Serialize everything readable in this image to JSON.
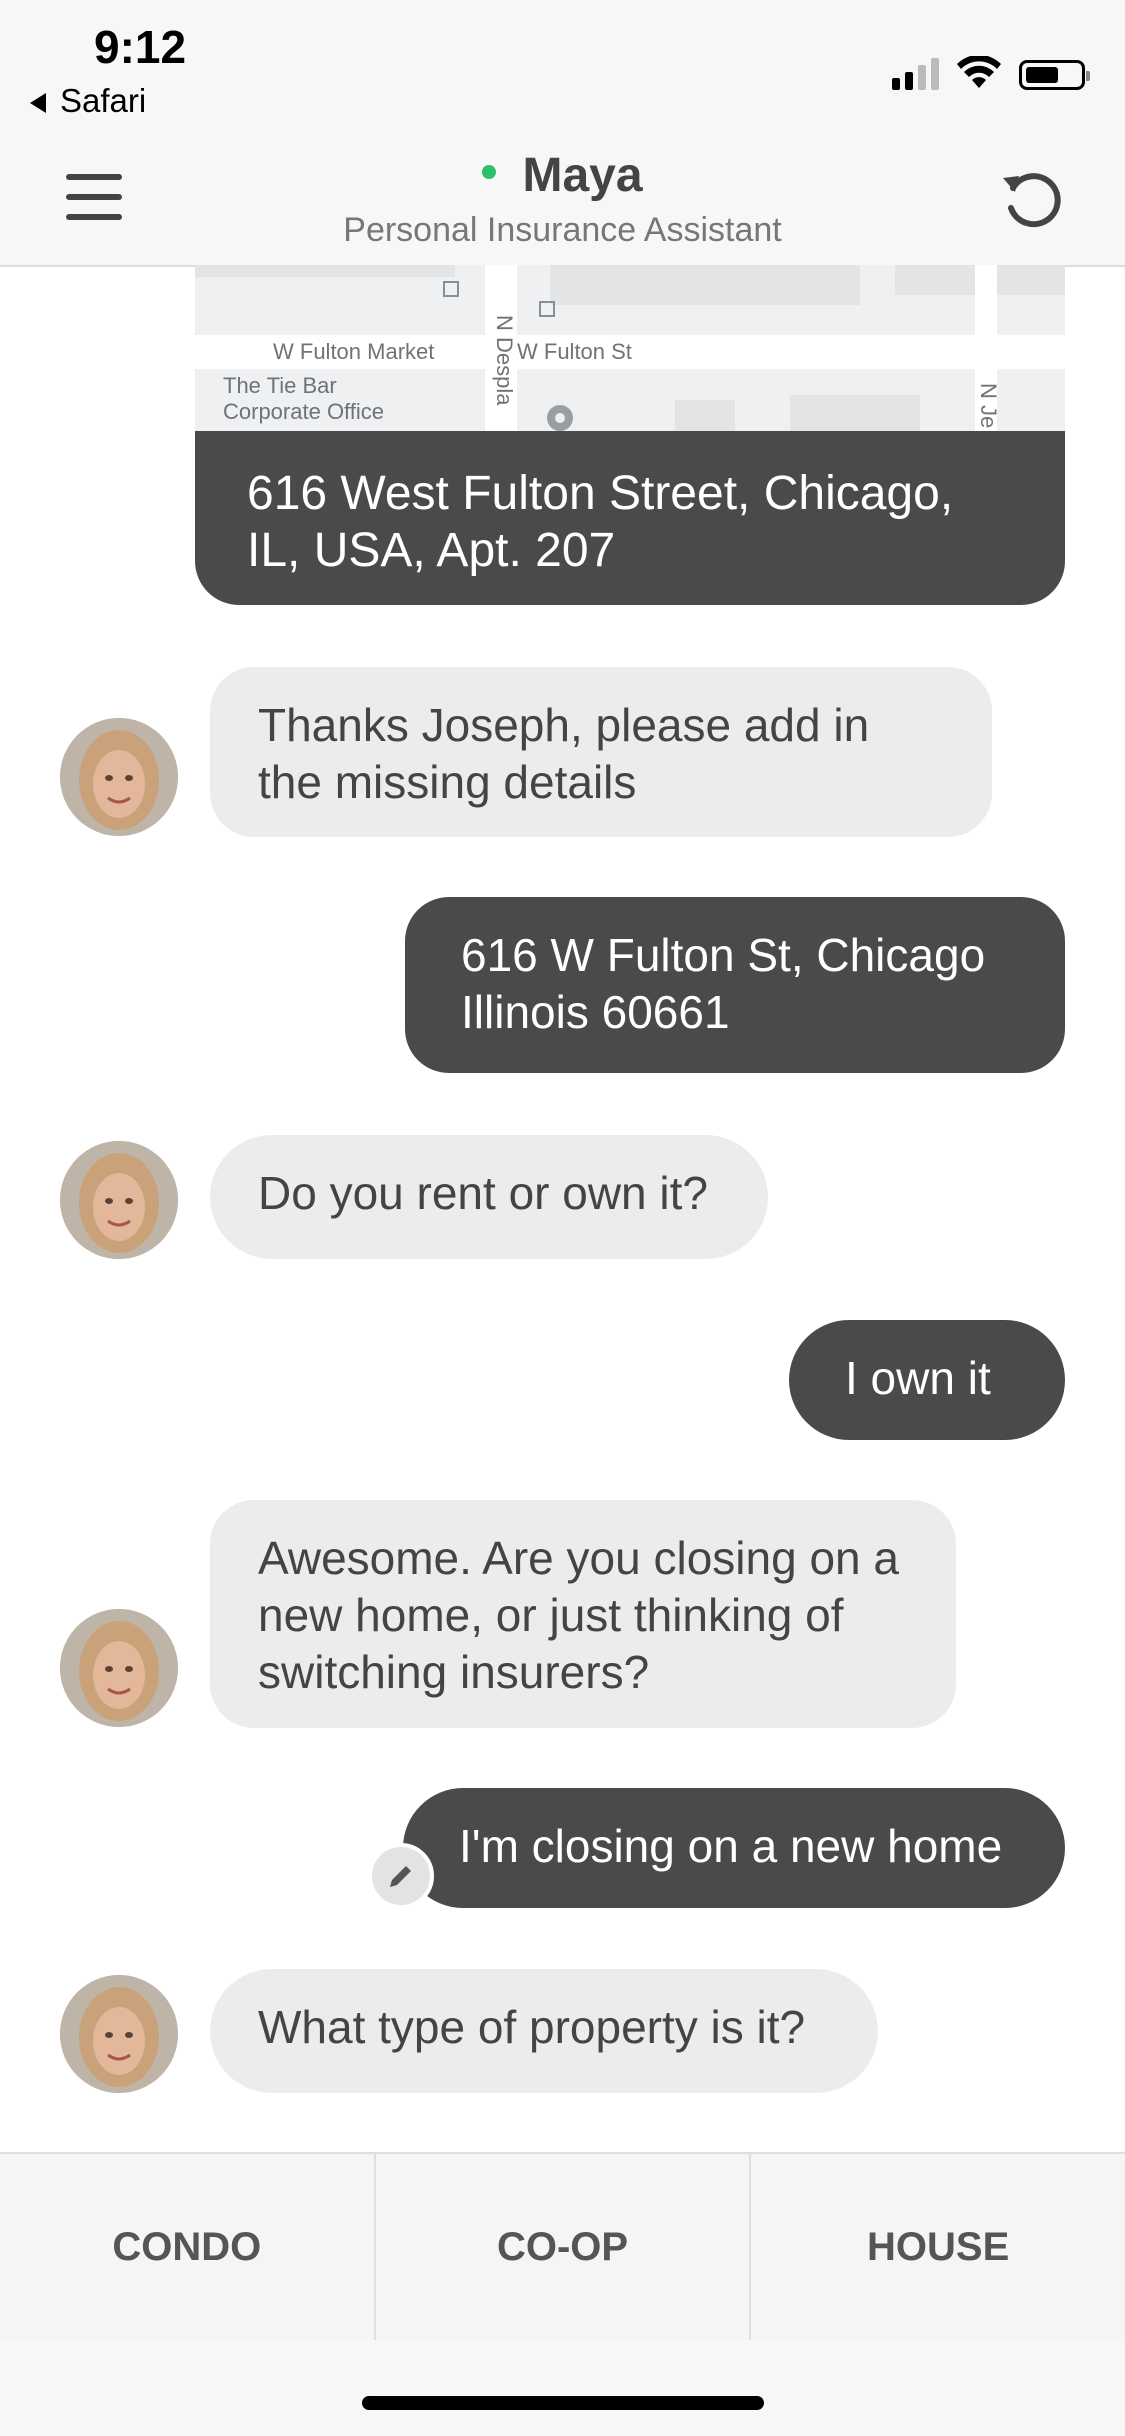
{
  "status_bar": {
    "time": "9:12",
    "back_app": "Safari"
  },
  "header": {
    "assistant_name": "Maya",
    "assistant_role": "Personal Insurance Assistant",
    "status_color": "#2fbf6b"
  },
  "map": {
    "labels": {
      "street1": "W Fulton Market",
      "street2": "W Fulton St",
      "poi_line1": "The Tie Bar",
      "poi_line2": "Corporate Office",
      "vertical_street": "N Despla",
      "vertical_street2": "N Je"
    }
  },
  "messages": [
    {
      "from": "user",
      "text": "616 West Fulton Street, Chicago, IL, USA, Apt. 207"
    },
    {
      "from": "assistant",
      "text": "Thanks Joseph, please add in the missing details"
    },
    {
      "from": "user",
      "text": "616 W Fulton St, Chicago Illinois 60661"
    },
    {
      "from": "assistant",
      "text": "Do you rent or own it?"
    },
    {
      "from": "user",
      "text": "I own it"
    },
    {
      "from": "assistant",
      "text": "Awesome. Are you closing on a new home, or just thinking of switching insurers?"
    },
    {
      "from": "user",
      "text": "I'm closing on a new home"
    },
    {
      "from": "assistant",
      "text": "What type of property is it?"
    }
  ],
  "quick_replies": [
    "CONDO",
    "CO-OP",
    "HOUSE"
  ],
  "colors": {
    "user_bubble": "#4a4a4a",
    "assistant_bubble": "#ececec"
  },
  "icons": {
    "menu": "hamburger-icon",
    "refresh": "restart-icon",
    "edit": "pencil-icon"
  }
}
